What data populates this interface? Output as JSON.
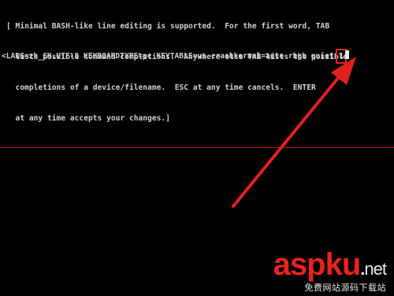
{
  "help_text": {
    "lines": [
      "[ Minimal BASH-like line editing is supported.  For the first word, TAB",
      "  lists possible command completions.  Anywhere else TAB lists the possible",
      "  completions of a device/filename.  ESC at any time cancels.  ENTER",
      "  at any time accepts your changes.]"
    ]
  },
  "command_line": {
    "text": "<LANG=zh_CN.UTF-8 KEYBOARDTYPE=pc KEYTABLE=us crashkernel=auto rhgb quiet ",
    "highlighted_arg": "1"
  },
  "annotation": {
    "highlight_color": "#e02020",
    "arrow_color": "#e02020"
  },
  "watermark": {
    "logo_asp": "asp",
    "logo_ku": "ku",
    "logo_dot": ".",
    "logo_net": "net",
    "subtitle": "免费网站源码下载站"
  },
  "colors": {
    "background": "#000000",
    "text": "#cfcfcf",
    "divider": "#c01818"
  }
}
